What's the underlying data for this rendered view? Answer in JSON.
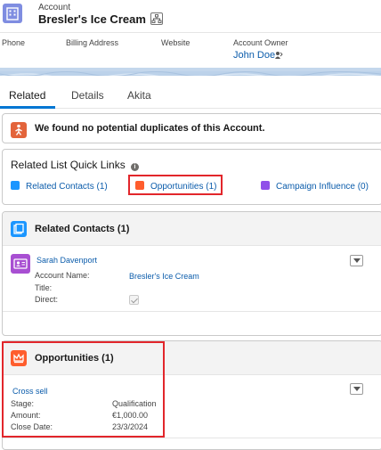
{
  "header": {
    "object_label": "Account",
    "record_title": "Bresler's Ice Cream"
  },
  "highlights": {
    "phone_label": "Phone",
    "billing_label": "Billing Address",
    "website_label": "Website",
    "owner_label": "Account Owner",
    "owner_value": "John Doe"
  },
  "tabs": [
    {
      "label": "Related",
      "active": true
    },
    {
      "label": "Details",
      "active": false
    },
    {
      "label": "Akita",
      "active": false
    }
  ],
  "duplicates": {
    "message": "We found no potential duplicates of this Account."
  },
  "quick_links": {
    "title": "Related List Quick Links",
    "links": [
      {
        "label": "Related Contacts (1)",
        "icon": "contacts-icon",
        "color": "#1b96ff"
      },
      {
        "label": "Opportunities (1)",
        "icon": "crown-icon",
        "color": "#ff5d2d"
      },
      {
        "label": "Campaign Influence (0)",
        "icon": "campaign-icon",
        "color": "#9050e9"
      }
    ]
  },
  "related_contacts": {
    "title": "Related Contacts (1)",
    "contact": {
      "name": "Sarah Davenport",
      "account_label": "Account Name:",
      "account_value": "Bresler's Ice Cream",
      "title_label": "Title:",
      "title_value": "",
      "direct_label": "Direct:"
    }
  },
  "opportunities": {
    "title": "Opportunities (1)",
    "record": {
      "name": "Cross sell",
      "stage_label": "Stage:",
      "stage_value": "Qualification",
      "amount_label": "Amount:",
      "amount_value": "€1,000.00",
      "close_label": "Close Date:",
      "close_value": "23/3/2024"
    }
  },
  "colors": {
    "link": "#0b5cab",
    "highlight_border": "#e2262b",
    "account_icon": "#7f8de1",
    "tab_active": "#0176d3"
  }
}
